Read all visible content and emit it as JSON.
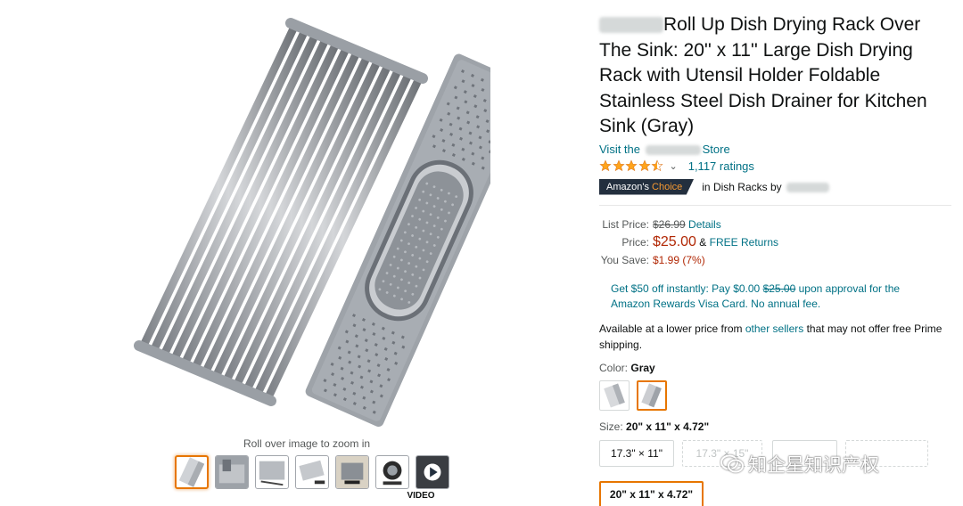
{
  "product": {
    "title": "Roll Up Dish Drying Rack Over The Sink: 20'' x 11'' Large Dish Drying Rack with Utensil Holder Foldable Stainless Steel Dish Drainer for Kitchen Sink (Gray)",
    "store_prefix": "Visit the",
    "store_suffix": "Store",
    "rating_stars": 4.5,
    "ratings_count": "1,117 ratings",
    "badge_prefix": "Amazon's",
    "badge_choice": "Choice",
    "badge_context": "in Dish Racks by"
  },
  "pricing": {
    "list_price_label": "List Price:",
    "list_price": "$26.99",
    "details_link": "Details",
    "price_label": "Price:",
    "price": "$25.00",
    "free_returns_sep": "&",
    "free_returns": "FREE Returns",
    "you_save_label": "You Save:",
    "you_save": "$1.99 (7%)"
  },
  "promo": {
    "text_a": "Get $50 off instantly: Pay $0.00",
    "strike": "$25.00",
    "text_b": "upon approval for the Amazon Rewards Visa Card. No annual fee."
  },
  "lower_price": {
    "prefix": "Available at a lower price from",
    "link": "other sellers",
    "suffix": "that may not offer free Prime shipping."
  },
  "color": {
    "label": "Color:",
    "selected": "Gray"
  },
  "size": {
    "label": "Size:",
    "selected": "20\" x 11\" x 4.72\"",
    "options": [
      "17.3\" × 11\"",
      "17.3\" × 15\"",
      "",
      "",
      "20\" x 11\" x 4.72\""
    ]
  },
  "gallery": {
    "zoom_hint": "Roll over image to zoom in",
    "video_label": "VIDEO",
    "thumb_count": 7
  },
  "watermark": {
    "text": "知企星知识产权"
  },
  "colors": {
    "link": "#007185",
    "price_red": "#b12704",
    "badge_bg": "#232f3e",
    "badge_accent": "#f69931",
    "star": "#ffa41c",
    "selected_border": "#e77600"
  },
  "icons": {
    "star": "star-icon",
    "caret": "chevron-down-icon",
    "play": "play-icon",
    "watermark": "wechat-icon"
  }
}
